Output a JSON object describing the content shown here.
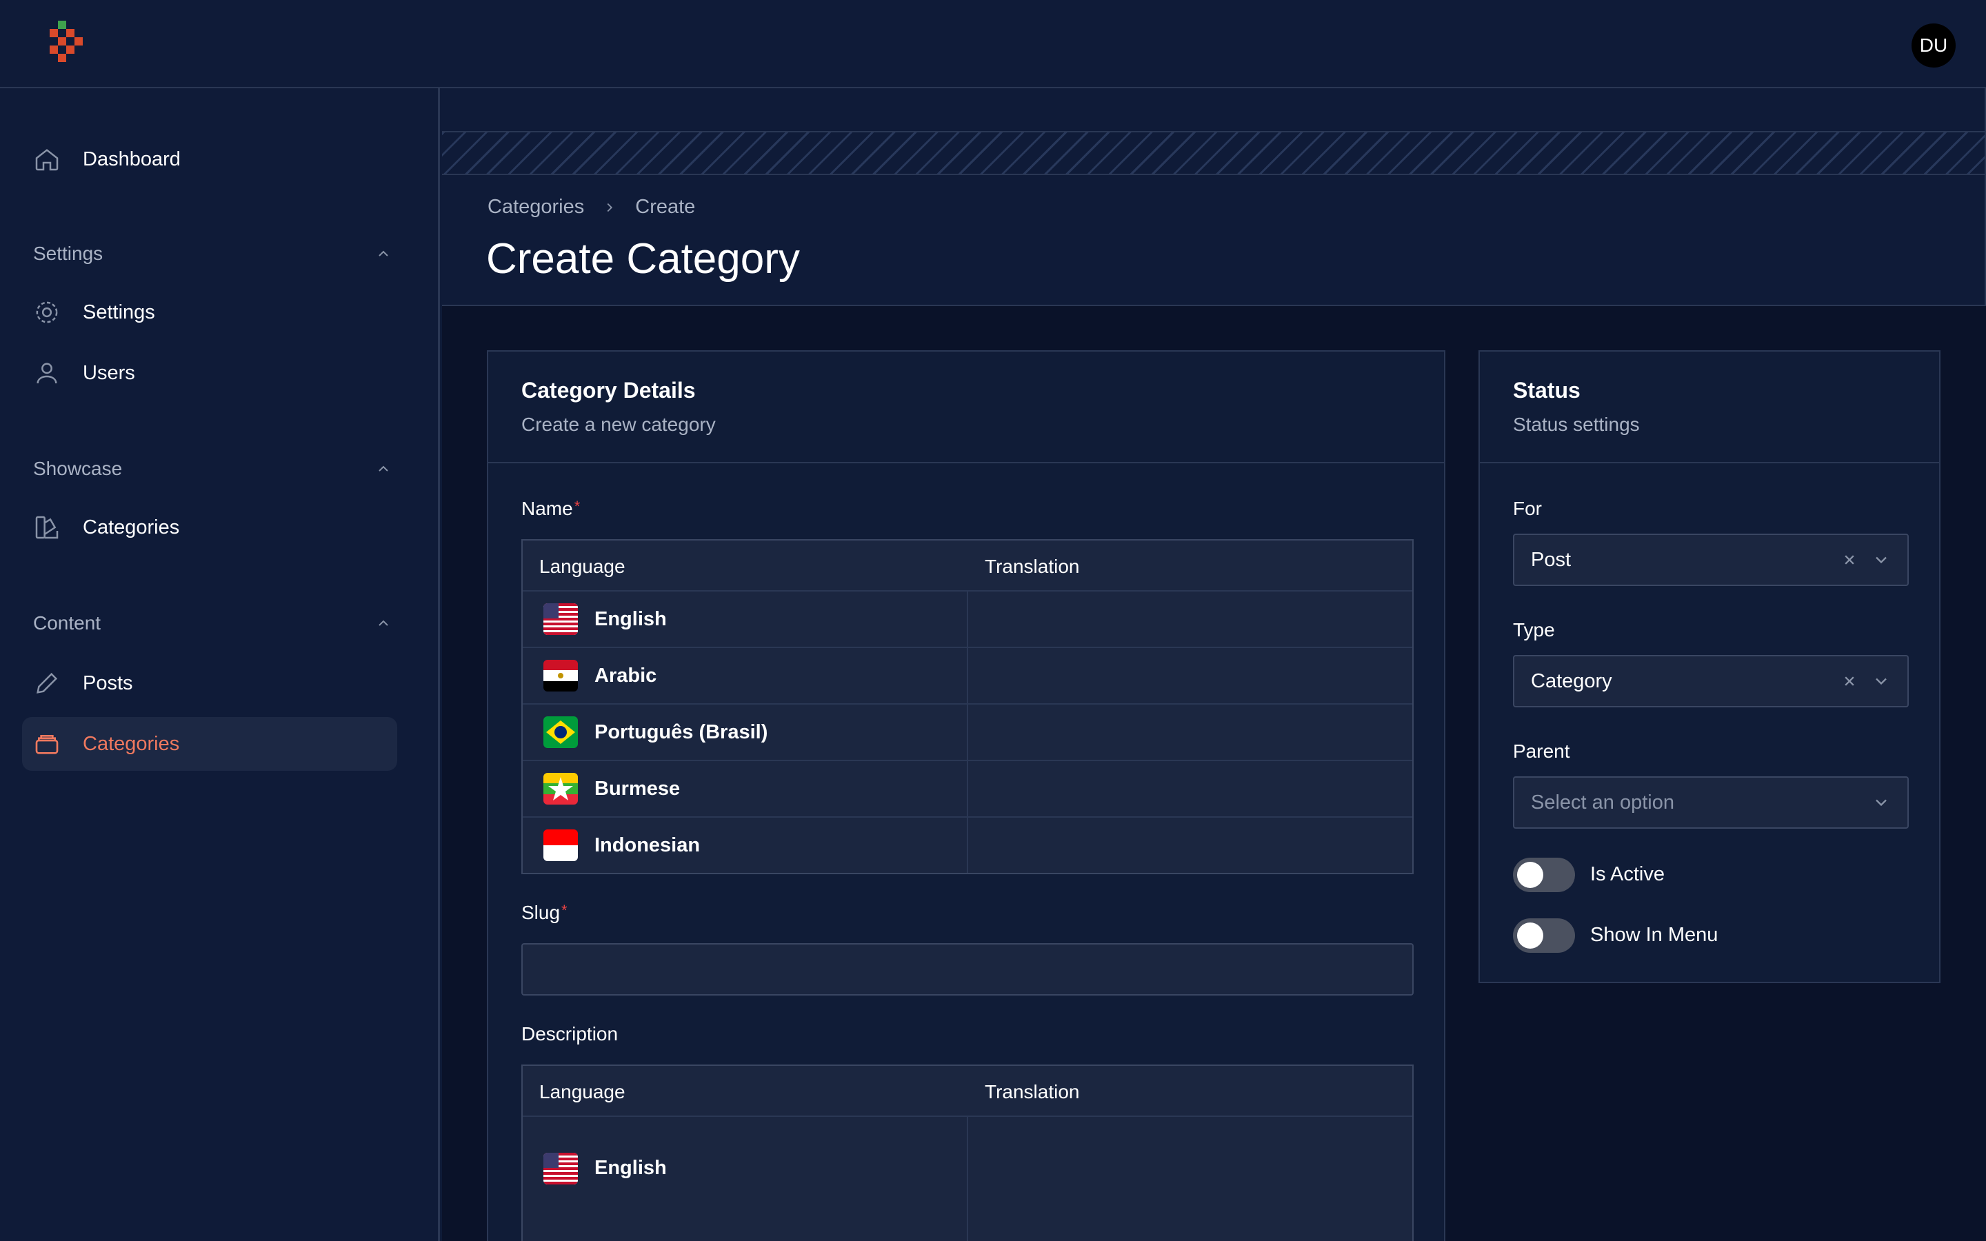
{
  "header": {
    "avatar_initials": "DU"
  },
  "sidebar": {
    "dashboard": "Dashboard",
    "groups": [
      {
        "label": "Settings",
        "items": [
          "Settings",
          "Users"
        ]
      },
      {
        "label": "Showcase",
        "items": [
          "Categories"
        ]
      },
      {
        "label": "Content",
        "items": [
          "Posts",
          "Categories"
        ]
      }
    ],
    "active_item": "Categories",
    "accent_color": "#f0795f"
  },
  "breadcrumb": [
    "Categories",
    "Create"
  ],
  "page_title": "Create Category",
  "details_card": {
    "title": "Category Details",
    "subtitle": "Create a new category",
    "name_label": "Name",
    "slug_label": "Slug",
    "description_label": "Description",
    "required_mark": "*",
    "table_headers": {
      "language": "Language",
      "translation": "Translation"
    },
    "languages": [
      "English",
      "Arabic",
      "Português (Brasil)",
      "Burmese",
      "Indonesian"
    ],
    "description_languages": [
      "English"
    ]
  },
  "status_card": {
    "title": "Status",
    "subtitle": "Status settings",
    "for_label": "For",
    "for_value": "Post",
    "type_label": "Type",
    "type_value": "Category",
    "parent_label": "Parent",
    "parent_placeholder": "Select an option",
    "is_active_label": "Is Active",
    "is_active": false,
    "show_in_menu_label": "Show In Menu",
    "show_in_menu": false
  }
}
